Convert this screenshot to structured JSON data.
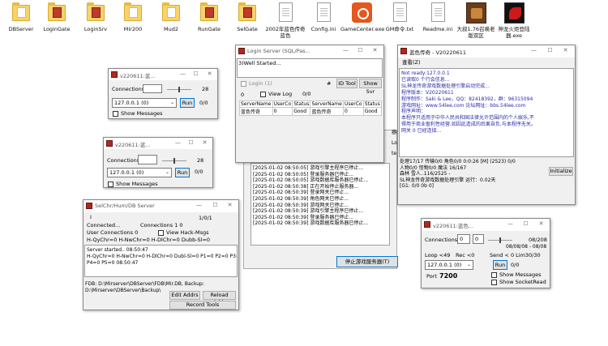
{
  "desktop": {
    "icons": [
      {
        "label": "DBServer",
        "icon": "folder-icon"
      },
      {
        "label": "LoginGate",
        "icon": "folder-icon"
      },
      {
        "label": "LoginSrv",
        "icon": "folder-icon"
      },
      {
        "label": "Mir200",
        "icon": "folder-icon"
      },
      {
        "label": "Mud2",
        "icon": "folder-icon"
      },
      {
        "label": "RunGate",
        "icon": "folder-icon"
      },
      {
        "label": "SelGate",
        "icon": "folder-icon"
      },
      {
        "label": "2002年蓝色传奇蓝色",
        "icon": "document-icon"
      },
      {
        "label": "Config.ini",
        "icon": "config-file-icon"
      },
      {
        "label": "GameCenter.exe",
        "icon": "gamecenter-app-icon"
      },
      {
        "label": "GM命令.txt",
        "icon": "text-file-icon"
      },
      {
        "label": "Readme.ini",
        "icon": "config-file-icon"
      },
      {
        "label": "大叔1.76召唤老版双区",
        "icon": "game-launcher-icon"
      },
      {
        "label": "神龙火炬登陆器.exe",
        "icon": "dragon-launcher-icon"
      }
    ]
  },
  "runGate1": {
    "title": "v220611:蓝...",
    "connections_label": "Connections",
    "connections_value": "28",
    "ip": "127.0.0.1 (0)",
    "run_label": "Run",
    "counter": "0/0",
    "show_messages": "Show Messages"
  },
  "runGate2": {
    "title": "v220611:蓝...",
    "connections_label": "Connections",
    "connections_value": "28",
    "ip": "127.0.0.1 (0)",
    "run_label": "Run",
    "counter": "0/0",
    "show_messages": "Show Messages"
  },
  "loginServer": {
    "title": "Login Server (SQL/Pas...",
    "status_line": "3)Well Started...",
    "login_label": "Login (1)",
    "hash": "#",
    "id_tool": "ID Tool",
    "show_svr": "Show Svr",
    "counter_left": "0",
    "view_log": "View Log",
    "view_log_counter": "0/0",
    "grid_headers": [
      "ServerName",
      "UserCo",
      "Status",
      "ServerName",
      "UserCo",
      "Status"
    ],
    "grid_row": [
      "蓝色传奇",
      "0",
      "Good",
      "蓝色传奇",
      "0",
      "Good"
    ]
  },
  "gameCenter": {
    "log_lines": [
      "[2025-01-02 08:50:05] 游戏引擎主程序已停止...",
      "[2025-01-02 08:50:05] 登录服务器已停止...",
      "[2025-01-02 08:50:05] 游戏数据库服务器已停止...",
      "[2025-01-02 08:50:38] 正在开始停止服务器...",
      "[2025-01-02 08:50:39] 登录网关已停止...",
      "[2025-01-02 08:50:39] 角色网关已停止...",
      "[2025-01-02 08:50:39] 游戏网关已停止...",
      "[2025-01-02 08:50:39] 游戏引擎主程序已停止...",
      "[2025-01-02 08:50:39] 登录服务器已停止...",
      "[2025-01-02 08:50:39] 游戏数据库服务器已停止..."
    ],
    "stop_button": "停止游戏服务器(T)",
    "side_fragments": [
      "器(L",
      "Lo",
      "te"
    ]
  },
  "m2Server": {
    "title": "蓝色传奇 - V20220611",
    "menu": "查看(Z)",
    "log_lines": [
      "Not ready:127.0.0.1",
      "已读取0 个行会信息...",
      "SL神龙传奇游戏数据处理引擎启动完成...",
      "程序版本：V20220611",
      "程序制作：Saki & Lee，QQ：82418392，群：96315094",
      "游戏网址：www.54lee.com  论坛网址：bbs.54lee.com",
      "程序声明：",
      "本程序只适用于中华人民共和国法律允许范围内的个人娱乐,不",
      "得用于商业盈利性经营,如因此造成的后果自负,与本程序无关。",
      "网关 0 已经连接..."
    ],
    "status_line1": "处理17/17 传输0/0 角色0/0     0:0:26 [M]          (2523)  0/0",
    "status_line2": "人物0/0 怪物0/0 魔法 16/167",
    "status_line3": "森林 雪人..116/2525 -",
    "status_line4": "SL神龙传奇游戏数据处理引擎           运行：0.02天",
    "status_line5": "[G1: 0/0 0b 0]",
    "initialize": "Initialize"
  },
  "selChr": {
    "title": "SelChr/Hum/DB Server",
    "cursor": "I",
    "ratio": "1/0/1",
    "connected": "Connected...",
    "connections": "Connections 1     0",
    "user_connections": "User Connections 0",
    "view_hack": "View Hack-Msgs",
    "h_row": "H-QyChr=0      H-NwChr=0     H-DlChr=0      Dubb-Sl=0",
    "log_lines": [
      "Server started.. 08:50:47",
      "H-QyChr=0 H-NwChr=0 H-DlChr=0 Dubl-Sl=0 P1=0 P2=0 P3=0",
      "P4=0 P5=0 08:50:47"
    ],
    "fdb_line1": "FDB: D:\\Mirserver\\DBServer\\FDB\\Mir.DB,  Backup:",
    "fdb_line2": "D:\\Mirserver\\DBServer\\Backup\\",
    "edit_addrs": "Edit Addrs",
    "reload_addr": "Reload Addr",
    "record_tools": "Record Tools"
  },
  "gateSmall": {
    "title": "v220611:蓝色...",
    "connections_label": "Connections",
    "conn_a": "0",
    "conn_b": "0",
    "ratio": "08/208",
    "ratio2": "08/08/08 - 08/08",
    "loop": "Loop <49",
    "rec": "Rec <0",
    "send": "Send < 0 Lim30/30",
    "ip": "127.0.0.1 (0)",
    "run_label": "Run",
    "counter": "0/0",
    "port_label": "Port",
    "port_value": "7200",
    "show_messages": "Show Messages",
    "show_socket": "Show SocketRead"
  }
}
